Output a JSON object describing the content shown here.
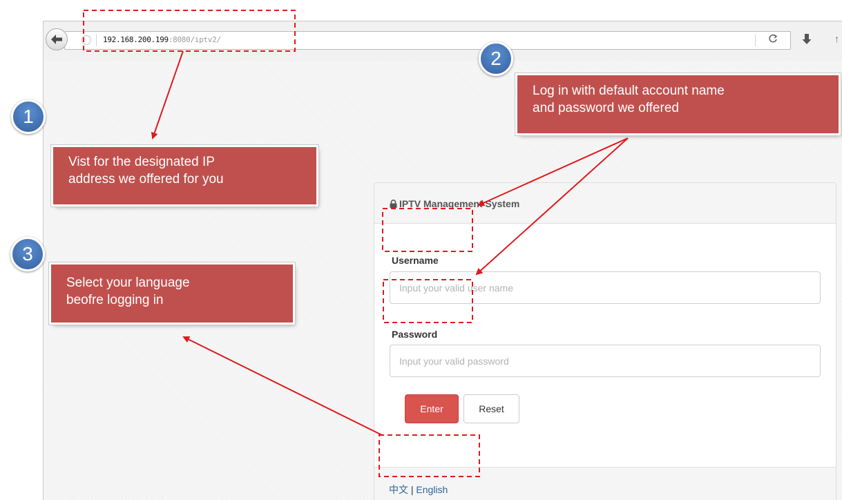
{
  "browser": {
    "url_host": "192.168.200.199",
    "url_rest": ":8080/iptv2/",
    "icons": {
      "back": "back-arrow-icon",
      "info": "globe-icon",
      "reload": "reload-icon",
      "download": "download-icon"
    },
    "reload_glyph": "C",
    "extra_glyph": "↑"
  },
  "login": {
    "title": "IPTV Management System",
    "username_label": "Username",
    "username_placeholder": "Input your valid user name",
    "password_label": "Password",
    "password_placeholder": "Input your valid password",
    "enter_label": "Enter",
    "reset_label": "Reset",
    "lang_zh": "中文",
    "lang_sep": " | ",
    "lang_en": "English"
  },
  "annotations": {
    "step1": {
      "number": "1",
      "text_l1": "Vist for the designated IP",
      "text_l2": "address we offered for you"
    },
    "step2": {
      "number": "2",
      "text_l1": "Log in with default account name",
      "text_l2": "and password we offered"
    },
    "step3": {
      "number": "3",
      "text_l1": "Select your language",
      "text_l2": "beofre logging in"
    }
  },
  "colors": {
    "callout": "#c0504d",
    "badge": "#3f6fb5",
    "arrow": "#e0181c",
    "enter_button": "#d9534f",
    "link": "#2a6496"
  }
}
